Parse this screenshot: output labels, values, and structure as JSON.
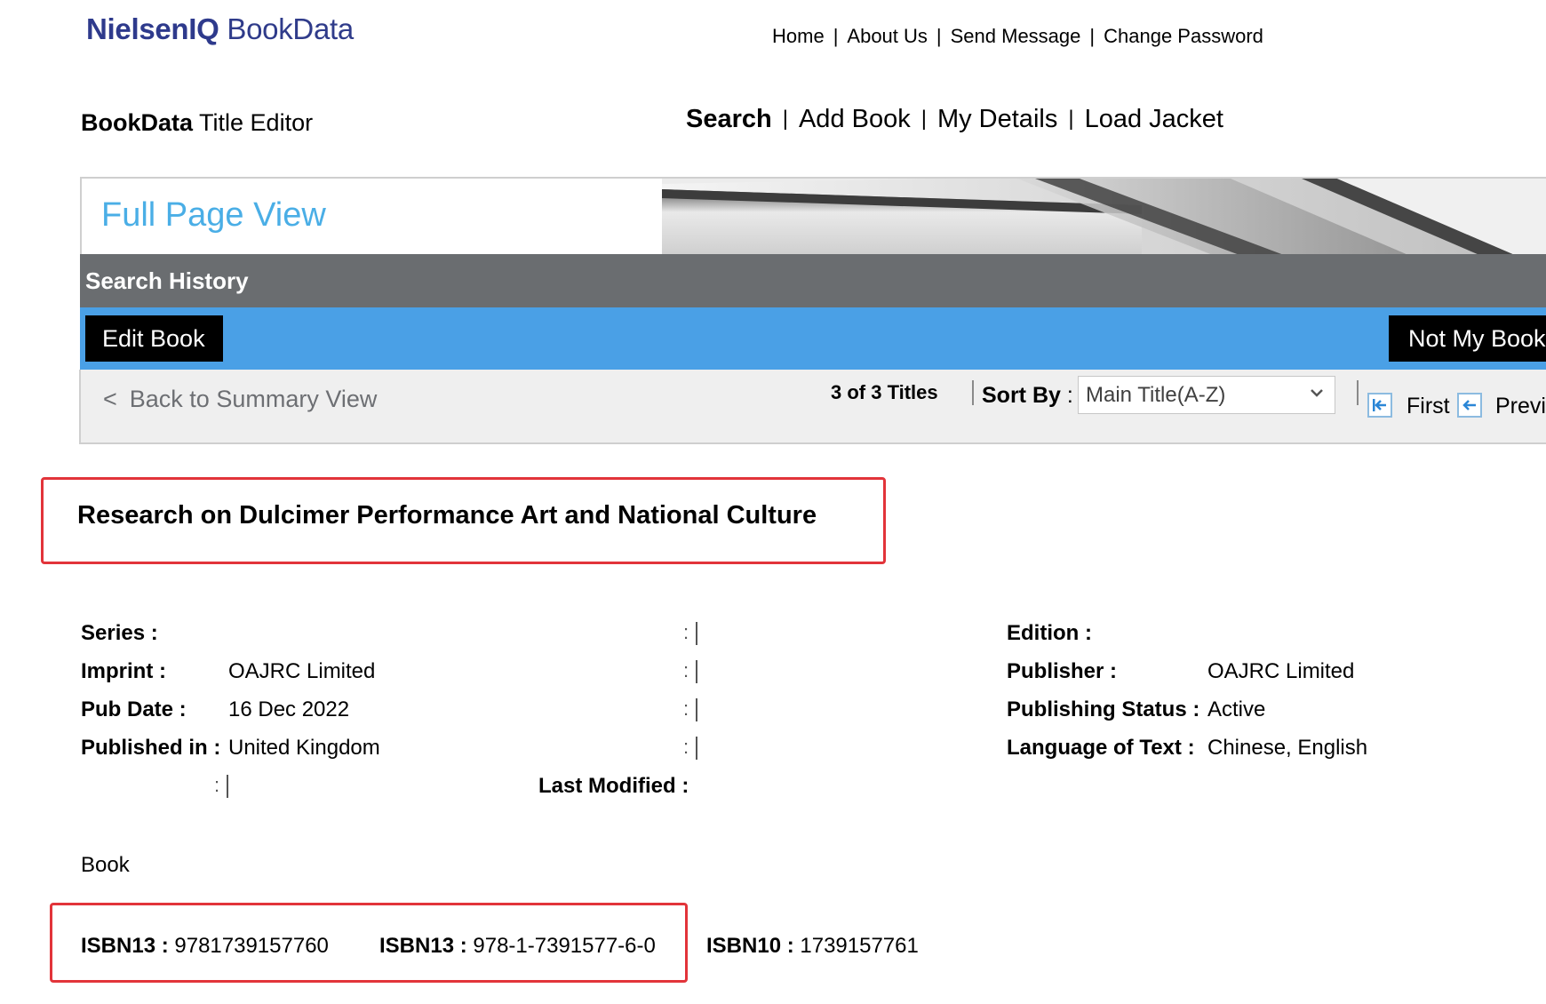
{
  "header": {
    "logo_brand": "NielsenIQ",
    "logo_product": "BookData",
    "top_nav": [
      "Home",
      "About Us",
      "Send Message",
      "Change Password"
    ]
  },
  "app": {
    "name_bold": "BookData",
    "name_rest": " Title Editor",
    "main_nav": [
      "Search",
      "Add Book",
      "My Details",
      "Load Jacket"
    ]
  },
  "banner": {
    "title": "Full Page View"
  },
  "history": {
    "label": "Search History"
  },
  "actions": {
    "edit_book": "Edit Book",
    "not_my_book": "Not My Book"
  },
  "results_nav": {
    "back_arrow": "<",
    "back_label": "Back to Summary View",
    "count": "3 of 3 Titles",
    "sort_label": "Sort By",
    "sort_colon": ":",
    "sort_value": "Main Title(A-Z)",
    "first_label": "First",
    "prev_label": "Previ"
  },
  "book": {
    "title": "Research on Dulcimer Performance Art and National Culture",
    "series_label": "Series :",
    "series_value": "",
    "imprint_label": "Imprint :",
    "imprint_value": "OAJRC Limited",
    "pub_date_label": "Pub Date :",
    "pub_date_value": "16 Dec 2022",
    "published_in_label": "Published in :",
    "published_in_value": "United Kingdom",
    "last_modified_label": "Last Modified :",
    "last_modified_value": "",
    "edition_label": "Edition :",
    "edition_value": "",
    "publisher_label": "Publisher :",
    "publisher_value": "OAJRC Limited",
    "publishing_status_label": "Publishing Status :",
    "publishing_status_value": "Active",
    "language_label": "Language of Text :",
    "language_value": "Chinese, English",
    "empty_colon": ":",
    "format": "Book",
    "isbn13_label": "ISBN13 :",
    "isbn13_value": "9781739157760",
    "isbn13_hyphen_label": "ISBN13 :",
    "isbn13_hyphen_value": "978-1-7391577-6-0",
    "isbn10_label": "ISBN10 :",
    "isbn10_value": "1739157761"
  },
  "colors": {
    "accent_blue": "#4aa0e6",
    "banner_title": "#4aaee6",
    "history_bar": "#6a6d70",
    "highlight_red": "#e2343a"
  },
  "icons": [
    "chevron-down-icon",
    "first-page-icon",
    "previous-page-icon"
  ]
}
